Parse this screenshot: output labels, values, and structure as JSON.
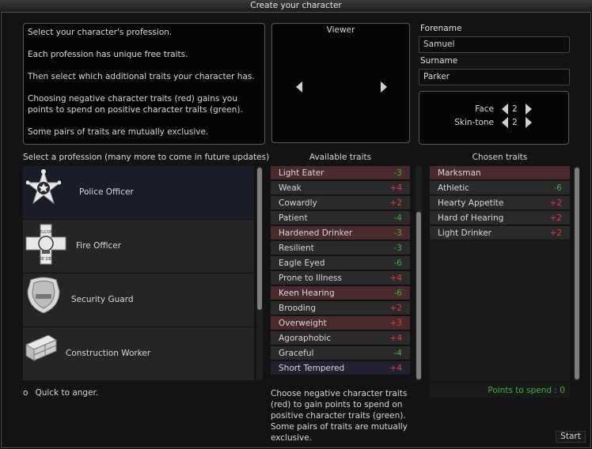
{
  "window": {
    "title": "Create your character"
  },
  "intro": {
    "lines": [
      "Select your character's profession.",
      "Each profession has unique free traits.",
      "Then select which additional traits your character has.",
      "Choosing negative character traits (red) gains you points to spend on positive character traits (green).",
      "Some pairs of traits are mutually exclusive."
    ]
  },
  "viewer": {
    "title": "Viewer"
  },
  "identity": {
    "forename_label": "Forename",
    "forename_value": "Samuel",
    "surname_label": "Surname",
    "surname_value": "Parker",
    "face_label": "Face",
    "face_value": "2",
    "skintone_label": "Skin-tone",
    "skintone_value": "2"
  },
  "professions": {
    "header": "Select a profession (many more to come in future updates)",
    "items": [
      {
        "label": "Police Officer",
        "icon": "police-badge-icon",
        "selected": true
      },
      {
        "label": "Fire Officer",
        "icon": "fire-badge-icon",
        "selected": false
      },
      {
        "label": "Security Guard",
        "icon": "security-badge-icon",
        "selected": false
      },
      {
        "label": "Construction Worker",
        "icon": "bricks-icon",
        "selected": false
      }
    ]
  },
  "available": {
    "header": "Available traits",
    "items": [
      {
        "label": "Light Eater",
        "cost": "-3",
        "kind": "positive",
        "highlight": "red-bg"
      },
      {
        "label": "Weak",
        "cost": "+4",
        "kind": "negative",
        "highlight": "none"
      },
      {
        "label": "Cowardly",
        "cost": "+2",
        "kind": "negative",
        "highlight": "none"
      },
      {
        "label": "Patient",
        "cost": "-4",
        "kind": "positive",
        "highlight": "none"
      },
      {
        "label": "Hardened Drinker",
        "cost": "-3",
        "kind": "positive",
        "highlight": "red-bg"
      },
      {
        "label": "Resilient",
        "cost": "-3",
        "kind": "positive",
        "highlight": "none"
      },
      {
        "label": "Eagle Eyed",
        "cost": "-6",
        "kind": "positive",
        "highlight": "none"
      },
      {
        "label": "Prone to Illness",
        "cost": "+4",
        "kind": "negative",
        "highlight": "none"
      },
      {
        "label": "Keen Hearing",
        "cost": "-6",
        "kind": "positive",
        "highlight": "red-bg"
      },
      {
        "label": "Brooding",
        "cost": "+2",
        "kind": "negative",
        "highlight": "none"
      },
      {
        "label": "Overweight",
        "cost": "+3",
        "kind": "negative",
        "highlight": "red-bg"
      },
      {
        "label": "Agoraphobic",
        "cost": "+4",
        "kind": "negative",
        "highlight": "none"
      },
      {
        "label": "Graceful",
        "cost": "-4",
        "kind": "positive",
        "highlight": "none"
      },
      {
        "label": "Short Tempered",
        "cost": "+4",
        "kind": "negative",
        "highlight": "dark-bg"
      }
    ]
  },
  "chosen": {
    "header": "Chosen traits",
    "items": [
      {
        "label": "Marksman",
        "cost": "",
        "kind": "free",
        "highlight": "red-bg"
      },
      {
        "label": "Athletic",
        "cost": "-6",
        "kind": "positive",
        "highlight": "none"
      },
      {
        "label": "Hearty Appetite",
        "cost": "+2",
        "kind": "negative",
        "highlight": "none"
      },
      {
        "label": "Hard of Hearing",
        "cost": "+2",
        "kind": "negative",
        "highlight": "none"
      },
      {
        "label": "Light Drinker",
        "cost": "+2",
        "kind": "negative",
        "highlight": "none"
      }
    ],
    "points_label": "Points to spend : 0"
  },
  "description": {
    "bullet": "o",
    "text": "Quick to anger."
  },
  "help": {
    "text": "Choose negative character traits (red) to gain points to spend on positive character traits (green). Some pairs of traits are mutually exclusive."
  },
  "buttons": {
    "start": "Start"
  },
  "colors": {
    "negative": "#e23a3a",
    "positive": "#3fae3f",
    "red_bg": "#4a2b2d",
    "selected_bg": "#1a1d28"
  }
}
